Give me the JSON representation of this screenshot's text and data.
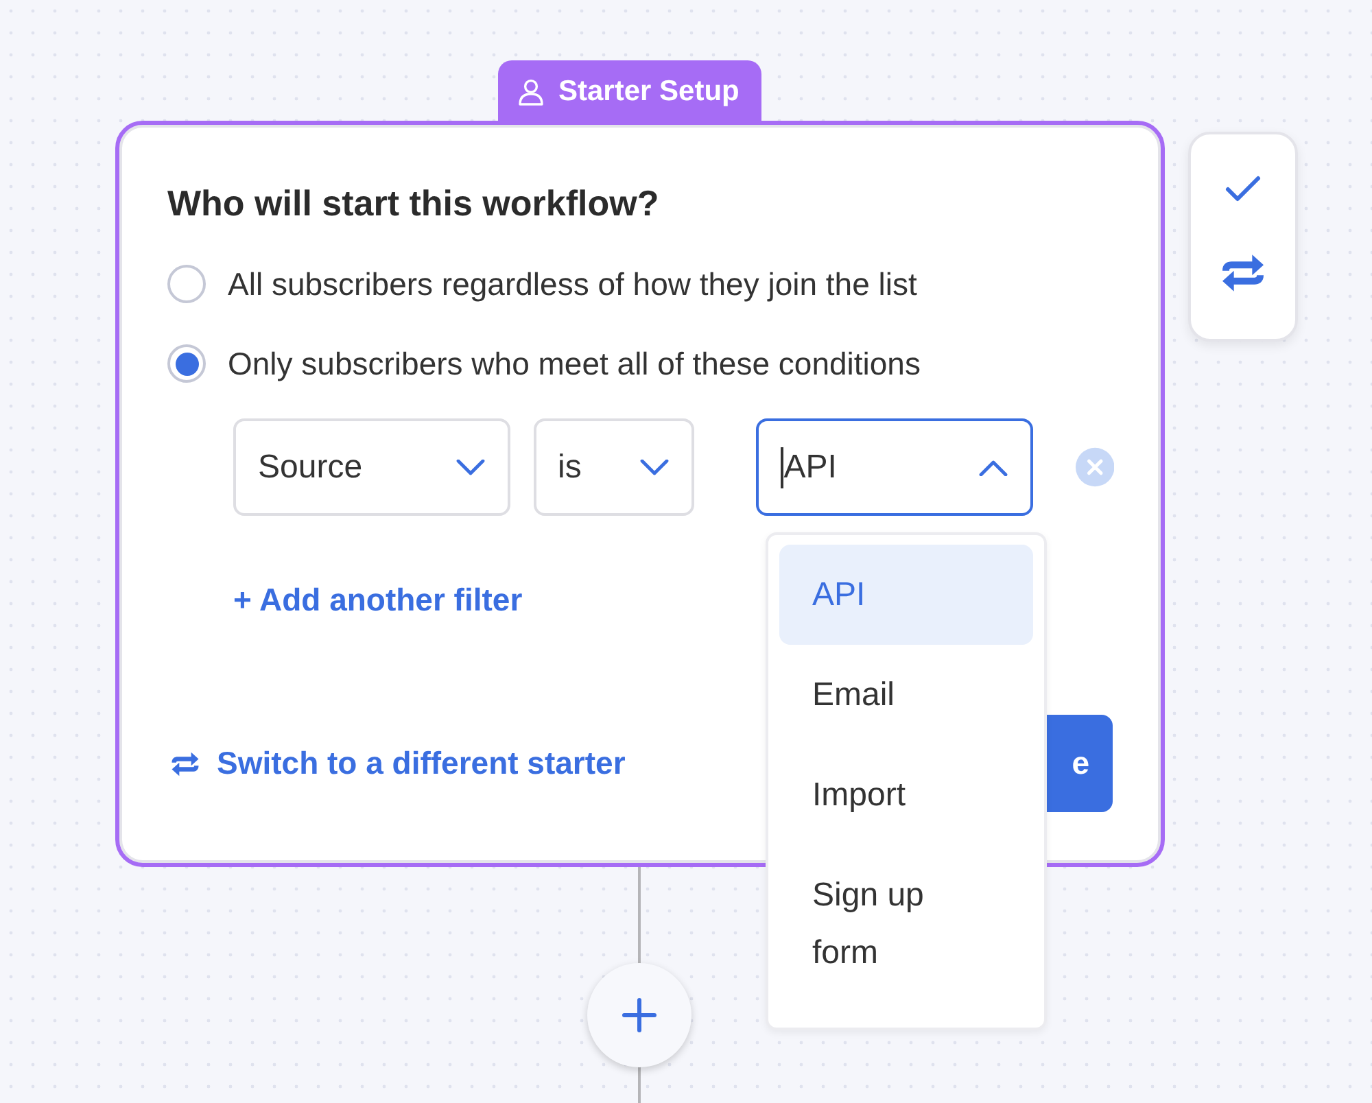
{
  "node_tab": {
    "label": "Starter Setup"
  },
  "question": "Who will start this workflow?",
  "options": [
    {
      "label": "All subscribers regardless of how they join the list",
      "selected": false
    },
    {
      "label": "Only subscribers who meet all of these conditions",
      "selected": true
    }
  ],
  "filter": {
    "field": "Source",
    "operator": "is",
    "value": "API",
    "open": true
  },
  "dropdown_options": [
    {
      "label": "API",
      "selected": true
    },
    {
      "label": "Email",
      "selected": false
    },
    {
      "label": "Import",
      "selected": false
    },
    {
      "label": "Sign up form",
      "selected": false
    }
  ],
  "add_filter": "+ Add another filter",
  "switch_link": "Switch to a different starter",
  "save_button": "e"
}
